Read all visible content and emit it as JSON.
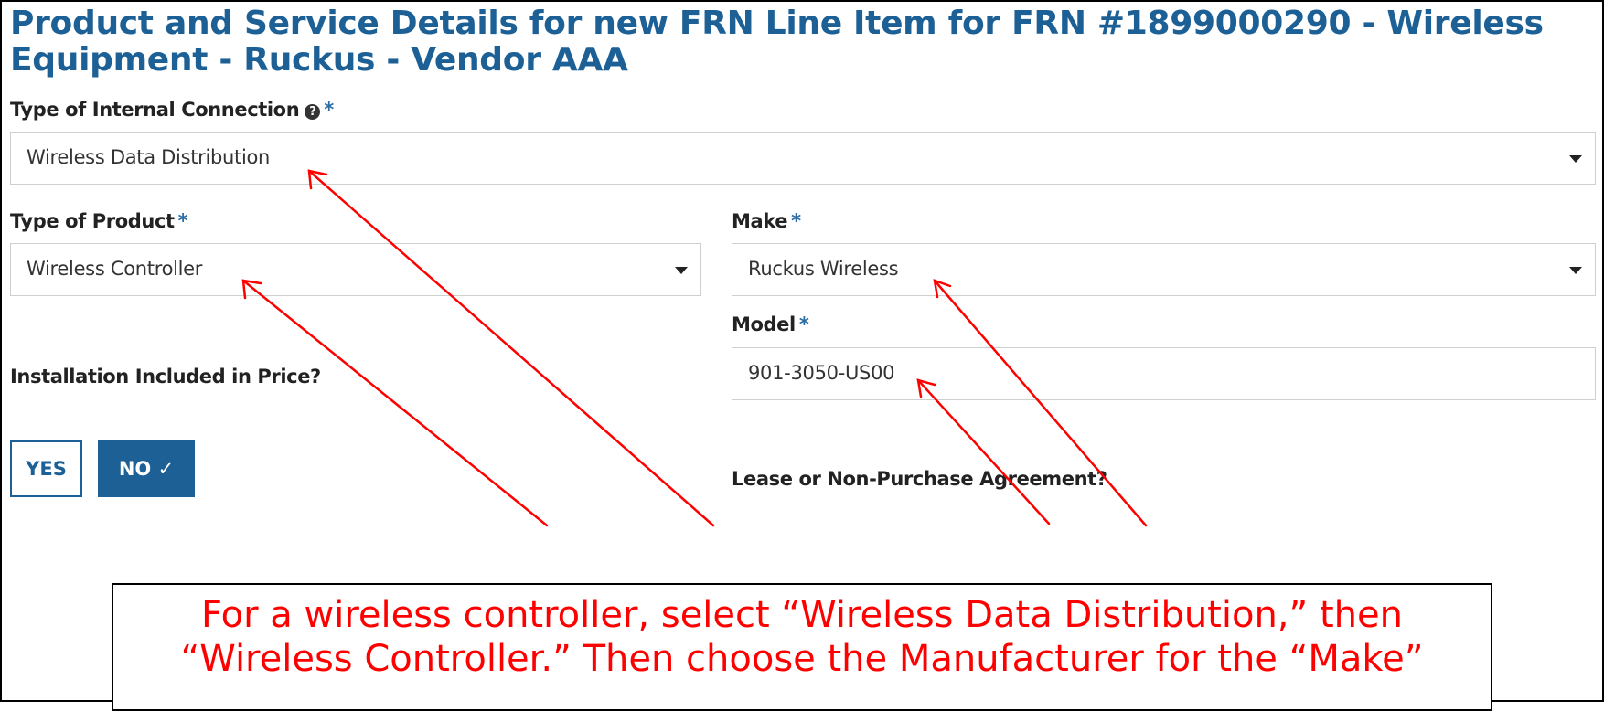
{
  "header": {
    "title": "Product and Service Details for new FRN Line Item for FRN #1899000290 - Wireless Equipment - Ruckus - Vendor AAA"
  },
  "form": {
    "internal_connection": {
      "label": "Type of Internal Connection",
      "required": "*",
      "help_icon": "question-circle",
      "value": "Wireless Data Distribution"
    },
    "product_type": {
      "label": "Type of Product",
      "required": "*",
      "value": "Wireless Controller"
    },
    "make": {
      "label": "Make",
      "required": "*",
      "value": "Ruckus Wireless"
    },
    "model": {
      "label": "Model",
      "required": "*",
      "value": "901-3050-US00"
    },
    "installation": {
      "label": "Installation Included in Price?",
      "yes_label": "YES",
      "no_label": "NO ✓",
      "selected": "NO"
    },
    "lease": {
      "label": "Lease or Non-Purchase Agreement?"
    }
  },
  "callout": {
    "text": "For a wireless controller, select “Wireless Data Distribution,” then “Wireless Controller.” Then choose the Manufacturer for the “Make”"
  },
  "colors": {
    "title": "#1d6096",
    "button_selected": "#1d6096",
    "annotation": "#ff0000",
    "required_mark": "#2a6ca3"
  }
}
